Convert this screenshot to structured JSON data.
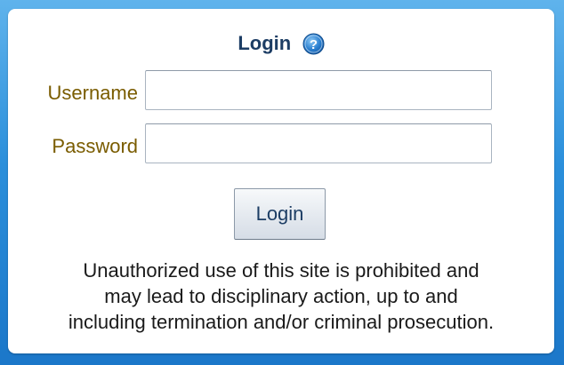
{
  "login": {
    "title": "Login",
    "help_icon": "help-question-icon",
    "username_label": "Username",
    "username_value": "",
    "password_label": "Password",
    "password_value": "",
    "button_label": "Login",
    "notice_lines": [
      "Unauthorized use of this site is prohibited and",
      "may lead to disciplinary action, up to and",
      "including termination and/or criminal prosecution."
    ]
  },
  "colors": {
    "background": "#2b8fdb",
    "title": "#1c3d64",
    "field_label": "#7a5c00",
    "help_icon": "#2a7fd0"
  }
}
